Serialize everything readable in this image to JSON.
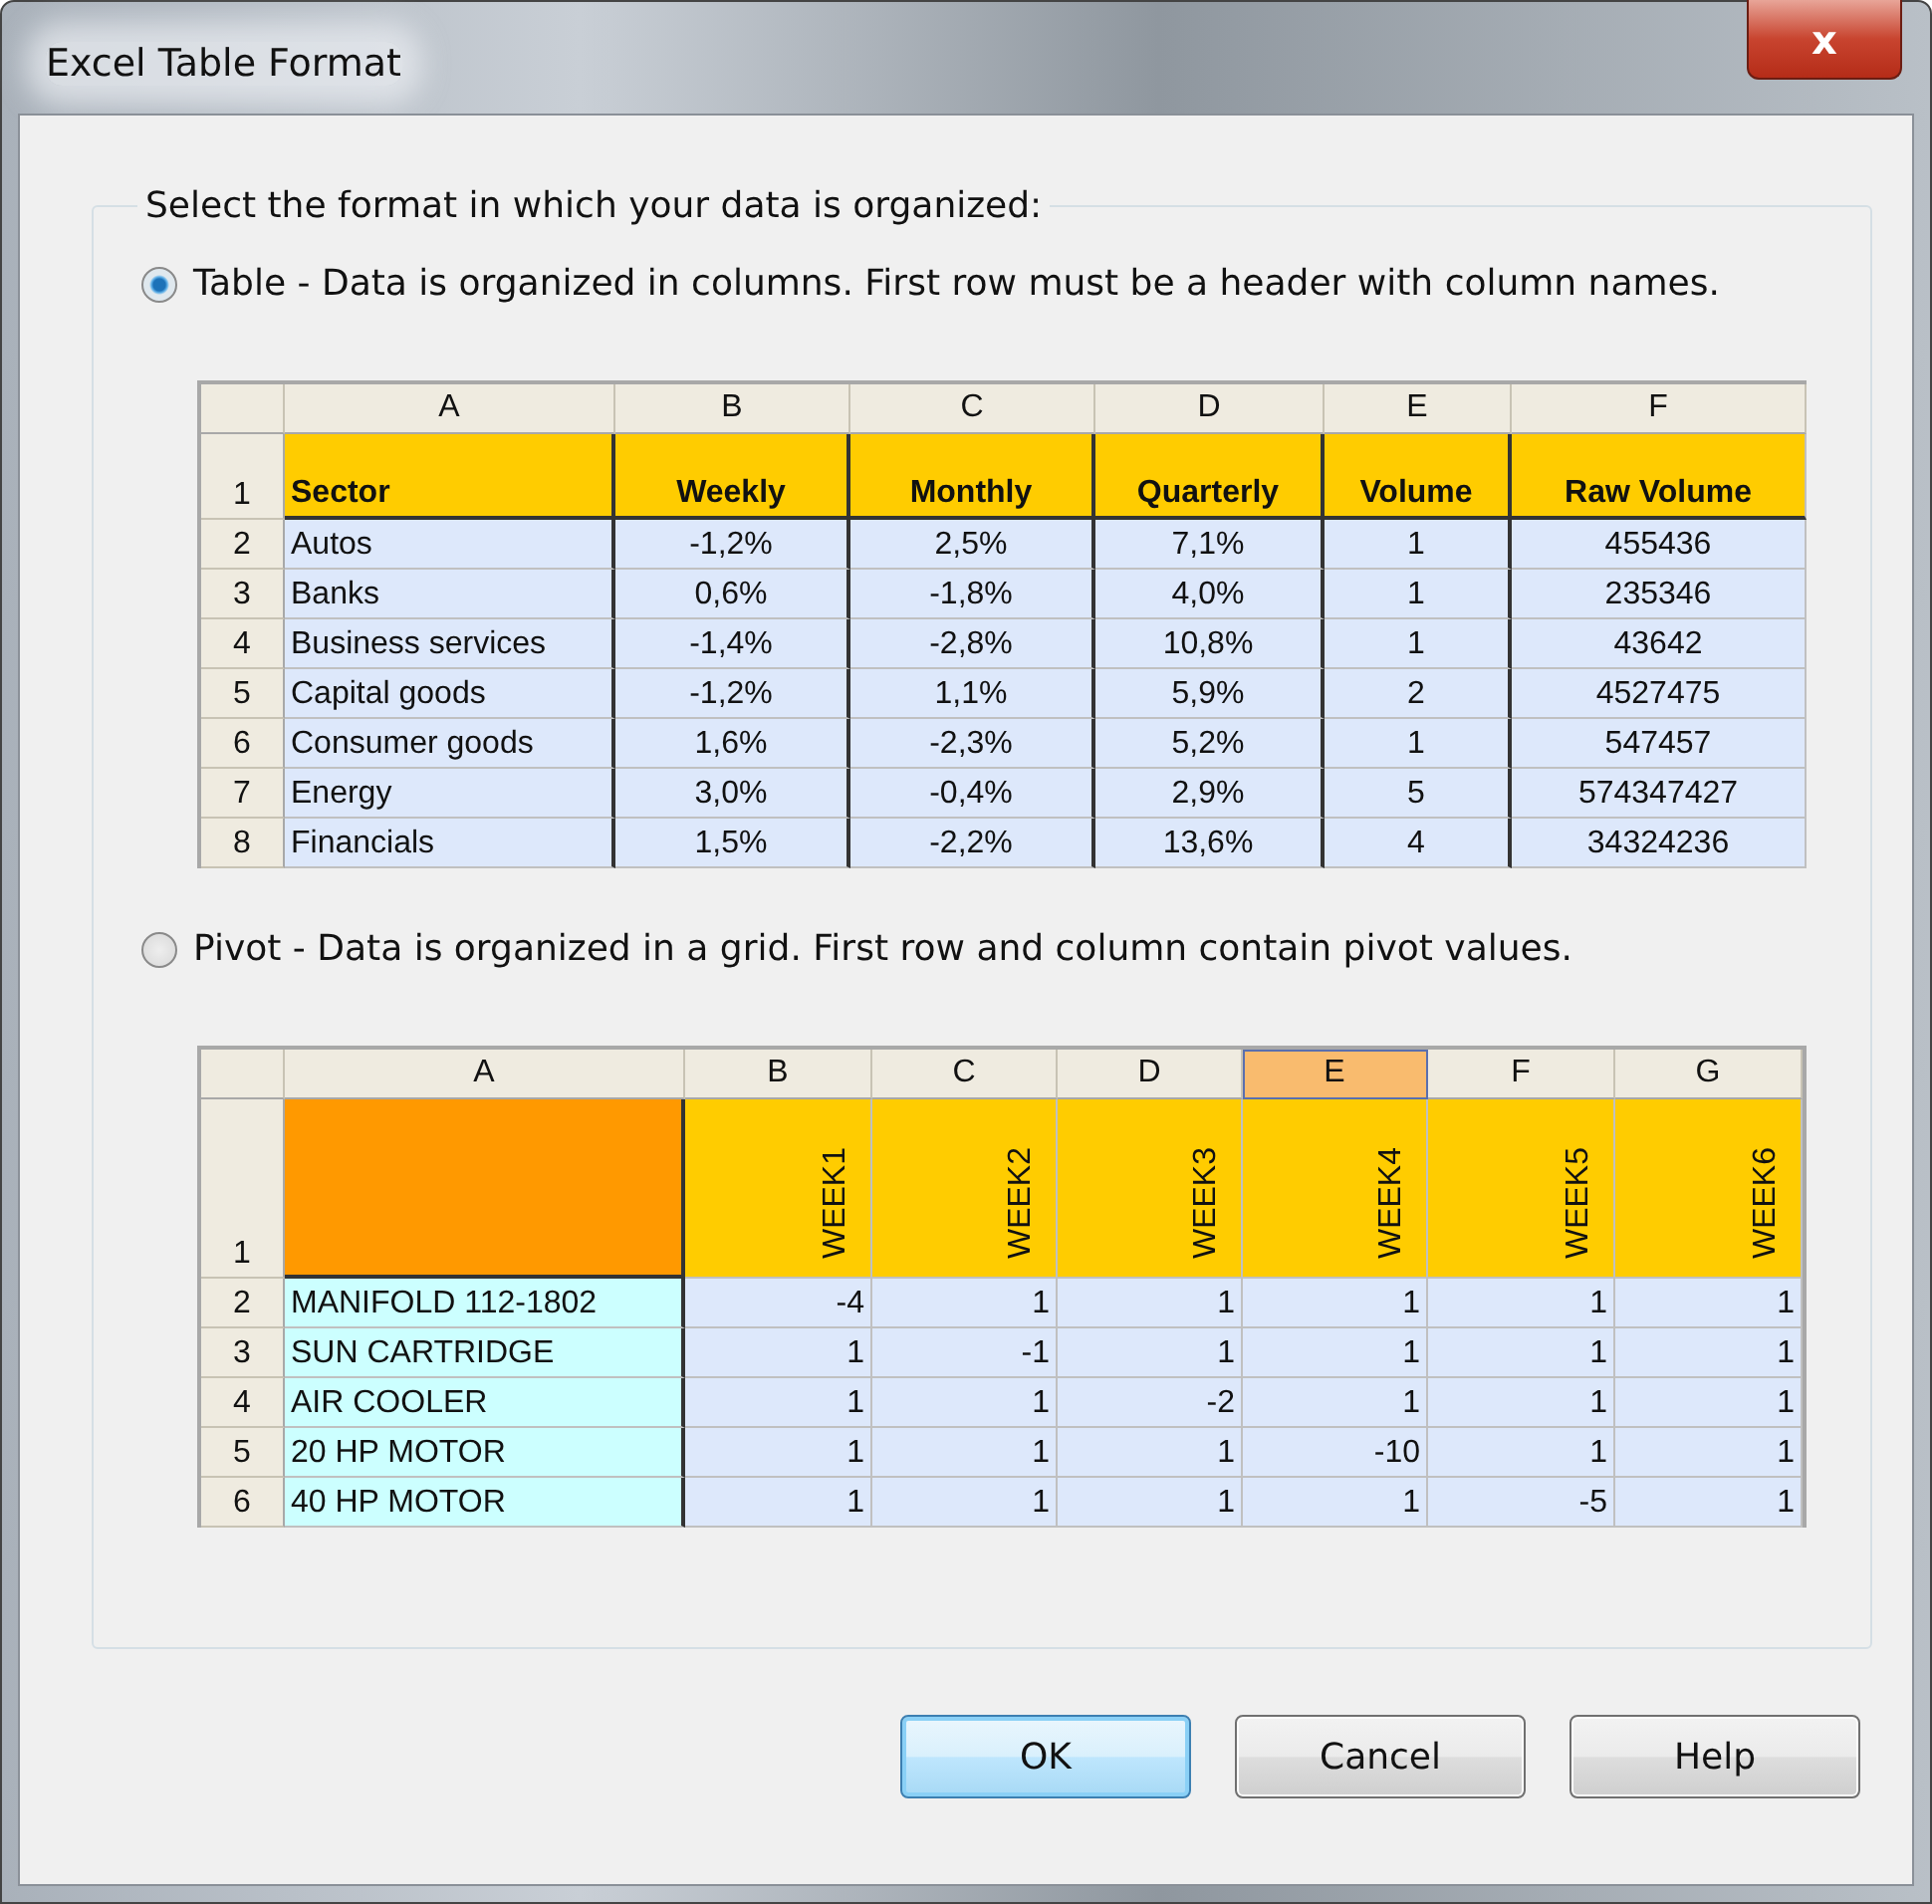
{
  "window": {
    "title": "Excel Table Format",
    "close": "x"
  },
  "group": {
    "legend": "Select the format in which your data is organized:"
  },
  "options": [
    {
      "label": "Table - Data is organized in columns. First row must be a header with column names.",
      "selected": true,
      "preview": {
        "kind": "table",
        "columns": [
          {
            "label": "A",
            "selected": false
          },
          {
            "label": "B",
            "selected": false
          },
          {
            "label": "C",
            "selected": false
          },
          {
            "label": "D",
            "selected": false
          },
          {
            "label": "E",
            "selected": false
          },
          {
            "label": "F",
            "selected": false
          }
        ],
        "rows": [
          {
            "number": "1",
            "cells": [
              "Sector",
              "Weekly",
              "Monthly",
              "Quarterly",
              "Volume",
              "Raw Volume"
            ]
          },
          {
            "number": "2",
            "cells": [
              "Autos",
              "-1,2%",
              "2,5%",
              "7,1%",
              "1",
              "455436"
            ]
          },
          {
            "number": "3",
            "cells": [
              "Banks",
              "0,6%",
              "-1,8%",
              "4,0%",
              "1",
              "235346"
            ]
          },
          {
            "number": "4",
            "cells": [
              "Business services",
              "-1,4%",
              "-2,8%",
              "10,8%",
              "1",
              "43642"
            ]
          },
          {
            "number": "5",
            "cells": [
              "Capital goods",
              "-1,2%",
              "1,1%",
              "5,9%",
              "2",
              "4527475"
            ]
          },
          {
            "number": "6",
            "cells": [
              "Consumer goods",
              "1,6%",
              "-2,3%",
              "5,2%",
              "1",
              "547457"
            ]
          },
          {
            "number": "7",
            "cells": [
              "Energy",
              "3,0%",
              "-0,4%",
              "2,9%",
              "5",
              "574347427"
            ]
          },
          {
            "number": "8",
            "cells": [
              "Financials",
              "1,5%",
              "-2,2%",
              "13,6%",
              "4",
              "34324236"
            ]
          }
        ]
      }
    },
    {
      "label": "Pivot - Data is organized in a grid. First row and column contain pivot values.",
      "selected": false,
      "preview": {
        "kind": "pivot",
        "columns": [
          {
            "label": "A",
            "selected": false
          },
          {
            "label": "B",
            "selected": false
          },
          {
            "label": "C",
            "selected": false
          },
          {
            "label": "D",
            "selected": false
          },
          {
            "label": "E",
            "selected": true
          },
          {
            "label": "F",
            "selected": false
          },
          {
            "label": "G",
            "selected": false
          }
        ],
        "rows": [
          {
            "number": "1",
            "cells": [
              "WEEK1",
              "WEEK2",
              "WEEK3",
              "WEEK4",
              "WEEK5",
              "WEEK6"
            ]
          },
          {
            "number": "2",
            "cells": [
              "MANIFOLD 112-1802",
              "-4",
              "1",
              "1",
              "1",
              "1",
              "1"
            ]
          },
          {
            "number": "3",
            "cells": [
              "SUN CARTRIDGE",
              "1",
              "-1",
              "1",
              "1",
              "1",
              "1"
            ]
          },
          {
            "number": "4",
            "cells": [
              "AIR COOLER",
              "1",
              "1",
              "-2",
              "1",
              "1",
              "1"
            ]
          },
          {
            "number": "5",
            "cells": [
              "20 HP MOTOR",
              "1",
              "1",
              "1",
              "-10",
              "1",
              "1"
            ]
          },
          {
            "number": "6",
            "cells": [
              "40 HP MOTOR",
              "1",
              "1",
              "1",
              "1",
              "-5",
              "1"
            ]
          }
        ]
      }
    }
  ],
  "buttons": [
    {
      "label": "OK",
      "default": true
    },
    {
      "label": "Cancel",
      "default": false
    },
    {
      "label": "Help",
      "default": false
    }
  ]
}
